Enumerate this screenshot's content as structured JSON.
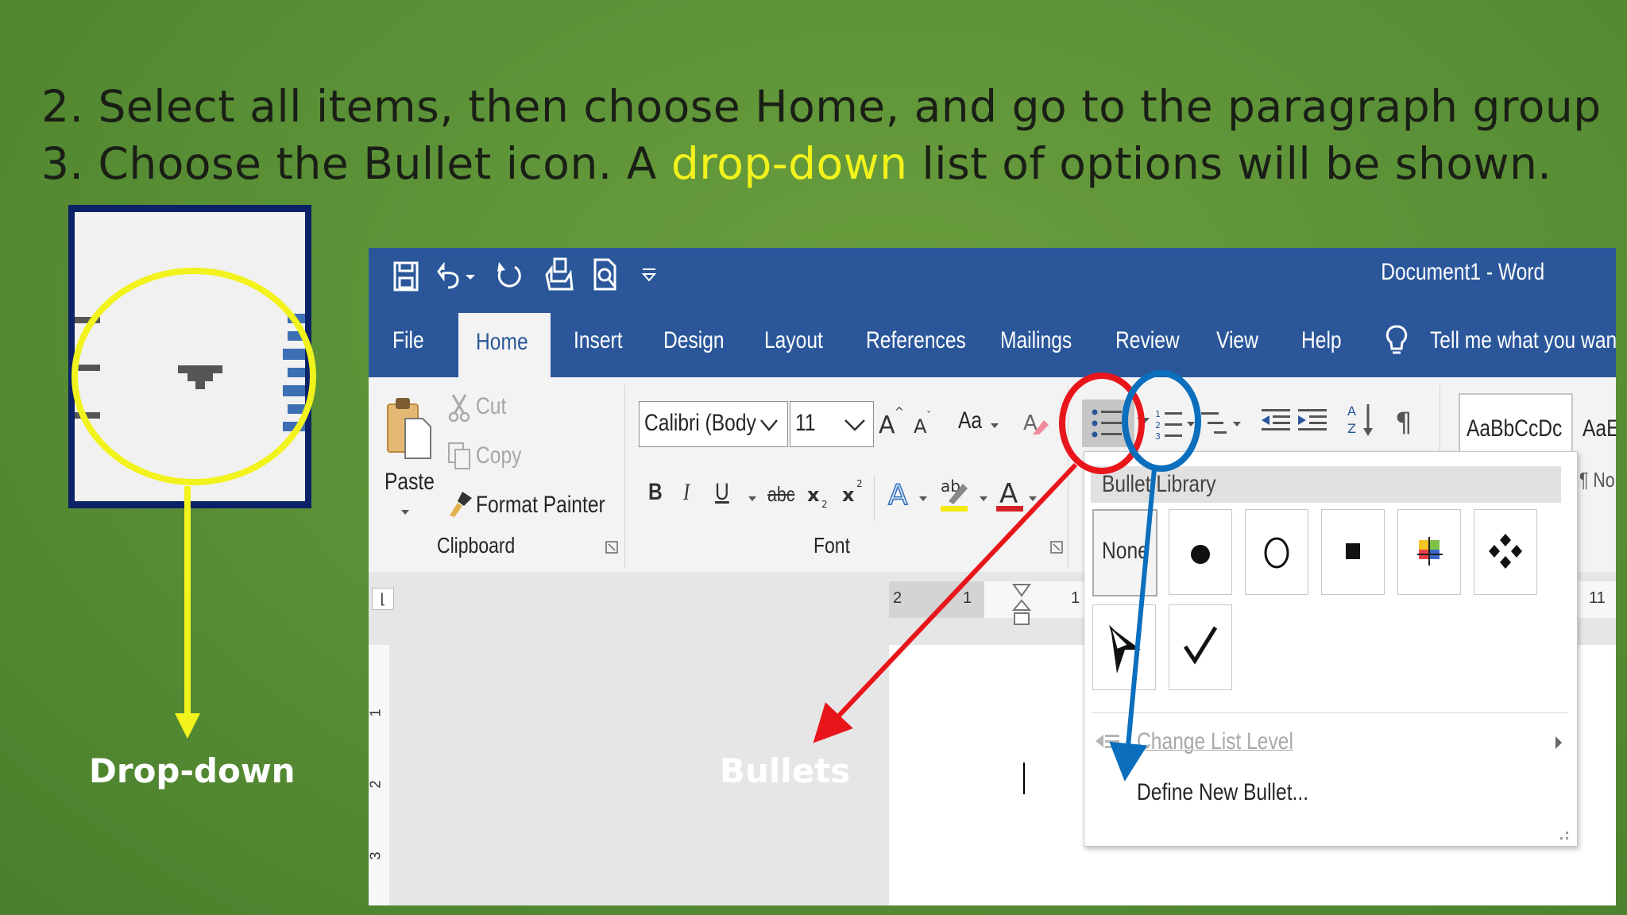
{
  "slide": {
    "line1": "2. Select all items, then choose Home, and go to the paragraph group",
    "line2_part1": "3. Choose the Bullet icon. A ",
    "line2_highlight": "drop-down",
    "line2_part2": " list of options will be shown.",
    "caption_dropdown": "Drop-down",
    "caption_bullets": "Bullets",
    "colors": {
      "background": "#5c9237",
      "highlight": "#f2f21c",
      "red_arrow": "#e8161b",
      "blue_arrow": "#0b6fbe",
      "yellow_arrow": "#f2f21c"
    }
  },
  "word": {
    "title": "Document1  -  Word",
    "qat": [
      "save-icon",
      "undo-icon",
      "redo-icon",
      "touch-mode-icon",
      "print-preview-icon",
      "customize-qat-icon"
    ],
    "tabs": [
      "File",
      "Home",
      "Insert",
      "Design",
      "Layout",
      "References",
      "Mailings",
      "Review",
      "View",
      "Help"
    ],
    "tell_me": "Tell me what you wan",
    "clipboard": {
      "paste": "Paste",
      "cut": "Cut",
      "copy": "Copy",
      "format_painter": "Format Painter",
      "group": "Clipboard"
    },
    "font": {
      "name": "Calibri (Body",
      "size": "11",
      "change_case": "Aa",
      "group": "Font"
    },
    "styles": {
      "style1": "AaBbCcDc",
      "style2": "AaE",
      "normal": "¶ No"
    },
    "ruler_marks": {
      "two": "2",
      "one": "1",
      "one_b": "1",
      "eleven": "11"
    },
    "vruler_marks": [
      "1",
      "2",
      "3"
    ]
  },
  "bullet_menu": {
    "header": "Bullet Library",
    "none_label": "None",
    "bullets": [
      "none",
      "filled-circle",
      "hollow-circle",
      "filled-square",
      "four-color-star",
      "four-diamonds",
      "arrowhead",
      "checkmark"
    ],
    "change_list_level": "Change List Level",
    "define_new_bullet": "Define New Bullet..."
  }
}
